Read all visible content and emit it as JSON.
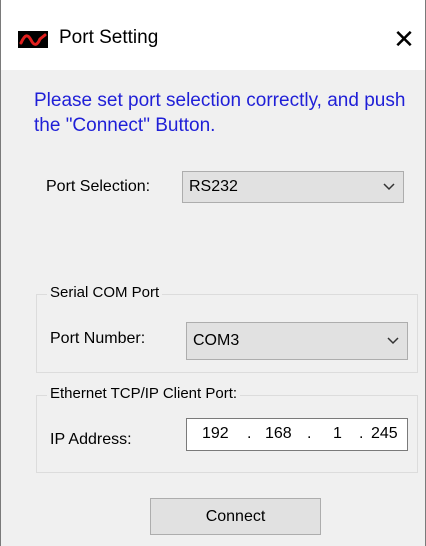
{
  "window": {
    "title": "Port Setting",
    "close_glyph": "✕",
    "app_icon": "app-logo-icon"
  },
  "instructions": "Please set port selection correctly, and push the \"Connect\" Button.",
  "port_selection": {
    "label": "Port Selection:",
    "value": "RS232"
  },
  "serial_group": {
    "title": "Serial COM Port",
    "port_number_label": "Port Number:",
    "port_number_value": "COM3"
  },
  "ethernet_group": {
    "title": "Ethernet TCP/IP Client Port:",
    "ip_label": "IP Address:",
    "ip_octets": [
      "192",
      "168",
      "1",
      "245"
    ]
  },
  "connect_button": "Connect",
  "colors": {
    "instruction_text": "#1f1fd7",
    "logo_red": "#e0201e"
  }
}
